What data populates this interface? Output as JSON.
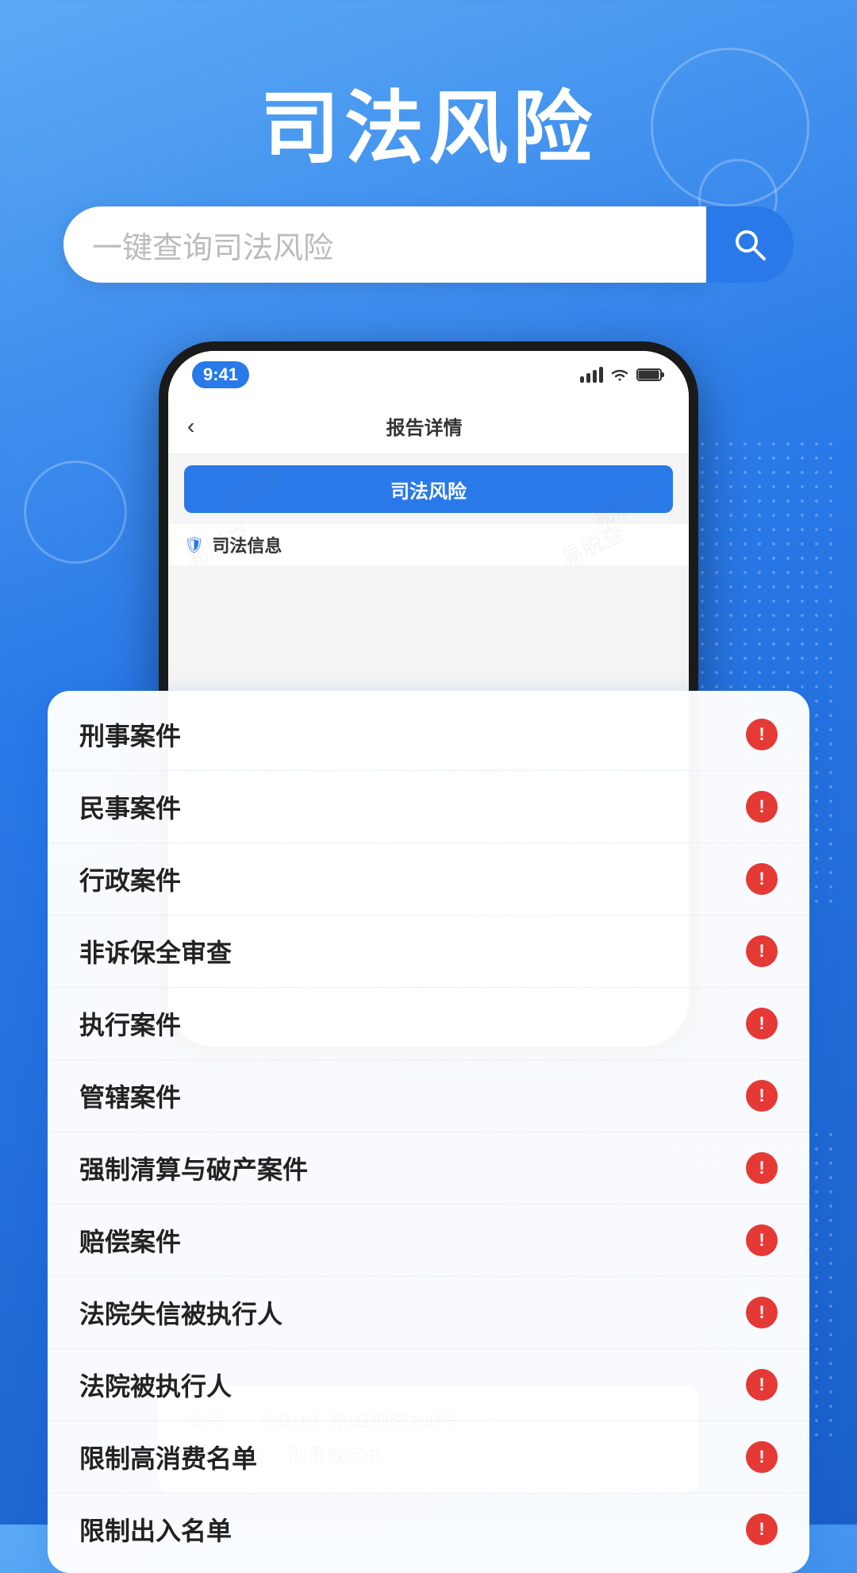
{
  "background": {
    "gradient_start": "#5baaf5",
    "gradient_end": "#1a5fc8"
  },
  "main_title": "司法风险",
  "search": {
    "placeholder": "一键查询司法风险",
    "button_aria": "搜索"
  },
  "phone": {
    "status_bar": {
      "time": "9:41"
    },
    "nav": {
      "back_label": "‹",
      "title": "报告详情"
    },
    "tab_button": "司法风险",
    "section": {
      "icon": "🛡",
      "title": "司法信息"
    },
    "watermark": "易脱查"
  },
  "list_items": [
    {
      "label": "刑事案件",
      "has_alert": true
    },
    {
      "label": "民事案件",
      "has_alert": true
    },
    {
      "label": "行政案件",
      "has_alert": true
    },
    {
      "label": "非诉保全审查",
      "has_alert": true
    },
    {
      "label": "执行案件",
      "has_alert": true
    },
    {
      "label": "管辖案件",
      "has_alert": true
    },
    {
      "label": "强制清算与破产案件",
      "has_alert": true
    },
    {
      "label": "赔偿案件",
      "has_alert": true
    },
    {
      "label": "法院失信被执行人",
      "has_alert": true
    },
    {
      "label": "法院被执行人",
      "has_alert": true
    },
    {
      "label": "限制高消费名单",
      "has_alert": true
    },
    {
      "label": "限制出入名单",
      "has_alert": true
    }
  ],
  "case_info": {
    "case_number_label": "案号：",
    "case_number_value": "（2018）京02刑终130号",
    "case_type_label": "案件类型：",
    "case_type_value": "刑事裁定书"
  },
  "alert_symbol": "!"
}
